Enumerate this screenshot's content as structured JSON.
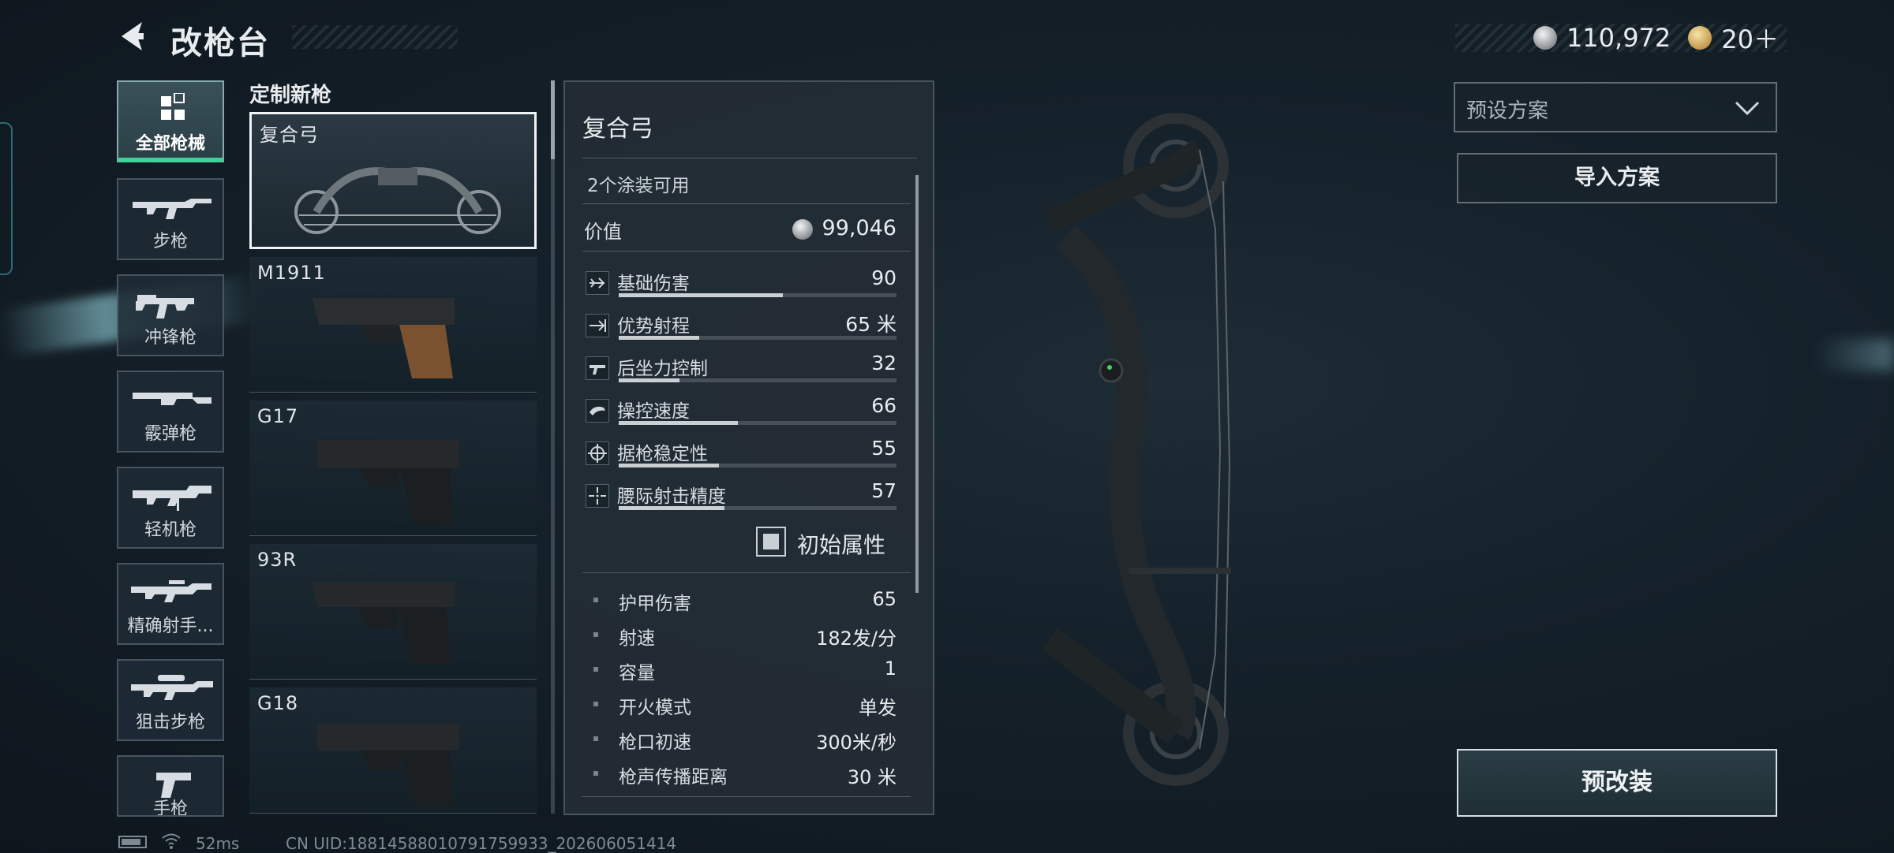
{
  "header": {
    "title": "改枪台"
  },
  "currency": {
    "silver": "110,972",
    "gold": "20＋"
  },
  "categories": [
    {
      "label": "全部枪械",
      "active": true
    },
    {
      "label": "步枪"
    },
    {
      "label": "冲锋枪"
    },
    {
      "label": "霰弹枪"
    },
    {
      "label": "轻机枪"
    },
    {
      "label": "精确射手..."
    },
    {
      "label": "狙击步枪"
    },
    {
      "label": "手枪"
    }
  ],
  "weapon_list": {
    "title": "定制新枪",
    "items": [
      {
        "name": "复合弓",
        "selected": true
      },
      {
        "name": "M1911"
      },
      {
        "name": "G17"
      },
      {
        "name": "93R"
      },
      {
        "name": "G18"
      }
    ]
  },
  "detail": {
    "title": "复合弓",
    "skins": "2个涂装可用",
    "value_label": "价值",
    "value": "99,046",
    "stats": [
      {
        "label": "基础伤害",
        "value": "90",
        "fill": 0.59,
        "icon": "damage-icon"
      },
      {
        "label": "优势射程",
        "value": "65 米",
        "fill": 0.29,
        "icon": "range-icon"
      },
      {
        "label": "后坐力控制",
        "value": "32",
        "fill": 0.22,
        "icon": "recoil-icon"
      },
      {
        "label": "操控速度",
        "value": "66",
        "fill": 0.43,
        "icon": "handling-icon"
      },
      {
        "label": "据枪稳定性",
        "value": "55",
        "fill": 0.36,
        "icon": "stability-icon"
      },
      {
        "label": "腰际射击精度",
        "value": "57",
        "fill": 0.38,
        "icon": "hipfire-icon"
      }
    ],
    "initial_attr_label": "初始属性",
    "attributes": [
      {
        "label": "护甲伤害",
        "value": "65"
      },
      {
        "label": "射速",
        "value": "182发/分"
      },
      {
        "label": "容量",
        "value": "1"
      },
      {
        "label": "开火模式",
        "value": "单发"
      },
      {
        "label": "枪口初速",
        "value": "300米/秒"
      },
      {
        "label": "枪声传播距离",
        "value": "30 米"
      }
    ]
  },
  "right": {
    "preset_placeholder": "预设方案",
    "import_label": "导入方案",
    "premod_label": "预改装"
  },
  "status": {
    "ping": "52ms",
    "uid": "CN UID:18814588010791759933_202606051414"
  },
  "colors": {
    "accent_green": "#3fd29a",
    "panel_bg": "#242e36"
  }
}
